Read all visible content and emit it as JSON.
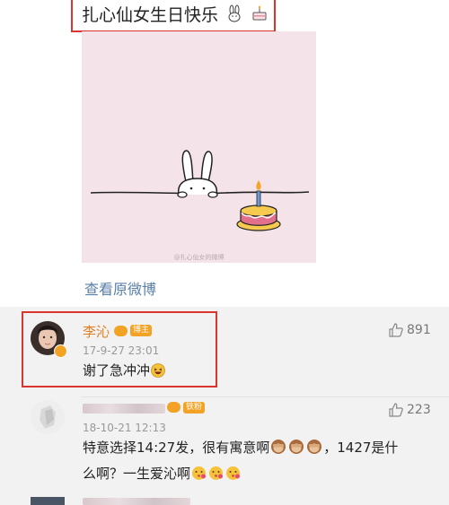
{
  "post": {
    "title": "扎心仙女生日快乐",
    "title_emojis": [
      "bunny-emoji",
      "cake-emoji"
    ],
    "image_watermark": "@扎心仙女的微博",
    "view_original_label": "查看原微博"
  },
  "comments": [
    {
      "username": "李沁",
      "badge": "博主",
      "timestamp": "17-9-27 23:01",
      "text": "谢了急冲冲",
      "likes": "891"
    },
    {
      "username": "",
      "badge": "铁粉",
      "timestamp": "18-10-21 12:13",
      "text_line1": "特意选择14:27发，很有寓意啊",
      "text_line1_tail": "，1427是什",
      "text_line2": "么啊？一生爱沁啊",
      "likes": "223"
    }
  ],
  "colors": {
    "highlight": "#d9352e",
    "username": "#e37f20",
    "link": "#5a7fa8",
    "image_bg": "#f4e4ea"
  }
}
